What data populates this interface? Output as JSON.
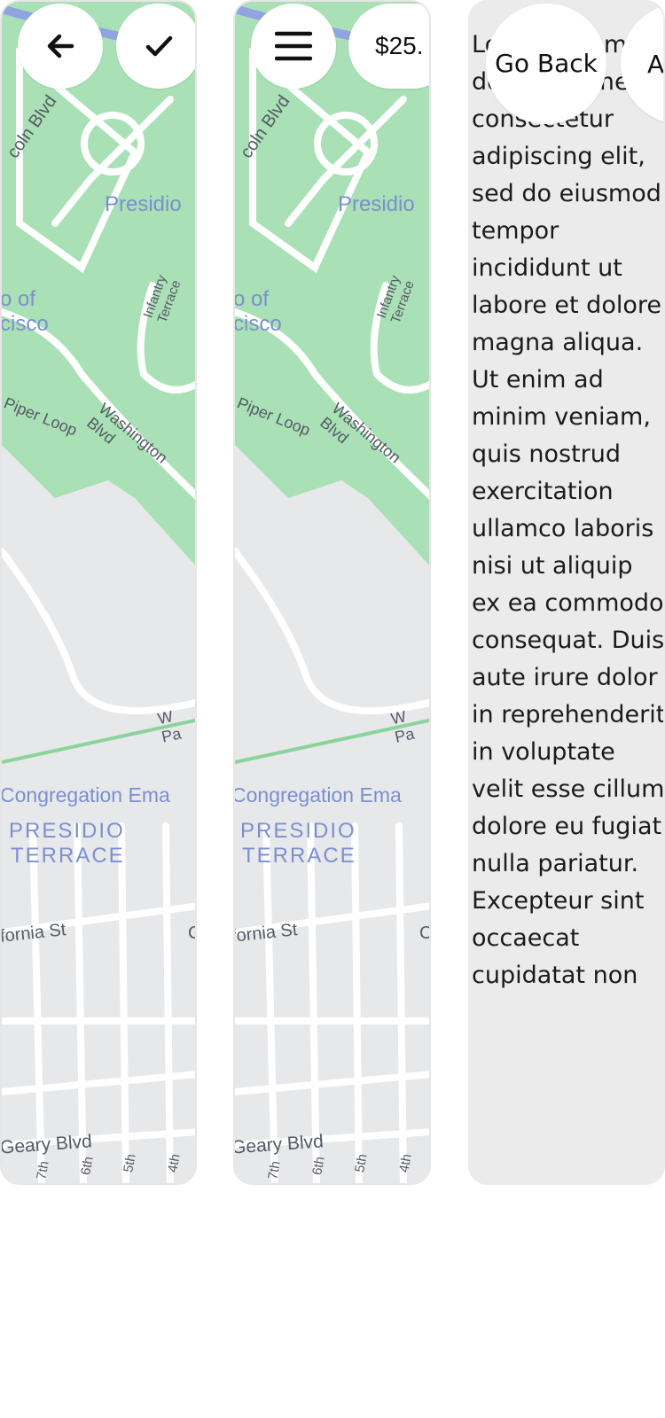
{
  "colors": {
    "park_green": "#a9e0b5",
    "road_white": "#ffffff",
    "land_gray": "#e7e8ea",
    "water_blue": "#8fa4e0",
    "label_blue": "#7b8fd0",
    "text_gray": "#555b66"
  },
  "panel1": {
    "back_icon": "arrow-left-icon",
    "confirm_icon": "checkmark-icon"
  },
  "panel2": {
    "menu_icon": "hamburger-menu-icon",
    "price_label": "$25."
  },
  "panel3": {
    "go_back_label": "Go Back",
    "next_button_label": "A",
    "body_text": "Lorem ipsum dolor sit amet, consectetur adipiscing elit, sed do eiusmod tempor incididunt ut labore et dolore magna aliqua. Ut enim ad minim veniam, quis nostrud exercitation ullamco laboris nisi ut aliquip ex ea commodo consequat. Duis aute irure dolor in reprehenderit in voluptate velit esse cillum dolore eu fugiat nulla pariatur. Excepteur sint occaecat cupidatat non"
  },
  "map_labels": {
    "presidio": "Presidio",
    "lincoln_blvd": "coln Blvd",
    "of": "o of",
    "cisco": "cisco",
    "infantry_terrace": "Infantry Terrace",
    "piper_loop": "Piper Loop",
    "washington_blvd": "Washington Blvd",
    "w_pa": "W Pa",
    "congregation": "Congregation Ema",
    "presidio_district_1": "PRESIDIO",
    "presidio_district_2": "TERRACE",
    "california_st": "fornia St",
    "c_fragment": "C",
    "geary_blvd": "Geary Blvd",
    "seventh": "7th",
    "sixth": "6th",
    "fifth": "5th",
    "fourth": "4th"
  }
}
